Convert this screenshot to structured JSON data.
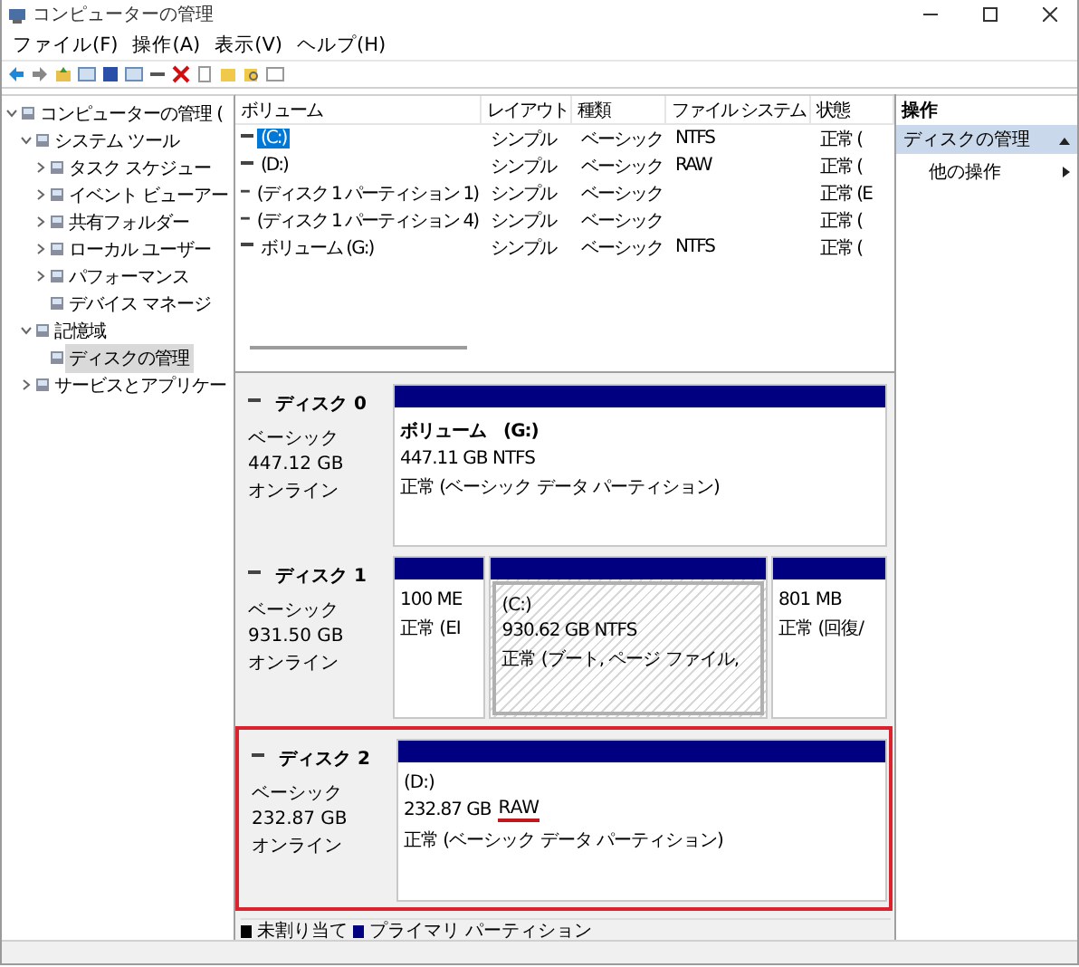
{
  "window": {
    "title": "コンピューターの管理"
  },
  "menu": [
    "ファイル(F)",
    "操作(A)",
    "表示(V)",
    "ヘルプ(H)"
  ],
  "tree": [
    {
      "label": "コンピューターの管理 (",
      "expanded": true,
      "selected": false,
      "children": [
        {
          "label": "システム ツール",
          "expanded": true,
          "selected": false,
          "children": [
            {
              "label": "タスク スケジュー",
              "expanded": false,
              "selected": false
            },
            {
              "label": "イベント ビューアー",
              "expanded": false,
              "selected": false
            },
            {
              "label": "共有フォルダー",
              "expanded": false,
              "selected": false
            },
            {
              "label": "ローカル ユーザー",
              "expanded": false,
              "selected": false
            },
            {
              "label": "パフォーマンス",
              "expanded": false,
              "selected": false
            },
            {
              "label": "デバイス マネージ",
              "selected": false
            }
          ]
        },
        {
          "label": "記憶域",
          "expanded": true,
          "selected": false,
          "children": [
            {
              "label": "ディスクの管理",
              "selected": true
            }
          ]
        },
        {
          "label": "サービスとアプリケー",
          "expanded": false,
          "selected": false
        }
      ]
    }
  ],
  "volume_table": {
    "columns": [
      "ボリューム",
      "レイアウト",
      "種類",
      "ファイル システム",
      "状態"
    ],
    "rows": [
      {
        "cells": [
          "(C:)",
          "シンプル",
          "ベーシック",
          "NTFS",
          "正常 ("
        ],
        "selected": true
      },
      {
        "cells": [
          "(D:)",
          "シンプル",
          "ベーシック",
          "RAW",
          "正常 ("
        ],
        "selected": false
      },
      {
        "cells": [
          "(ディスク 1 パーティション 1)",
          "シンプル",
          "ベーシック",
          "",
          "正常 (E"
        ],
        "selected": false
      },
      {
        "cells": [
          "(ディスク 1 パーティション 4)",
          "シンプル",
          "ベーシック",
          "",
          "正常 ("
        ],
        "selected": false
      },
      {
        "cells": [
          "ボリューム (G:)",
          "シンプル",
          "ベーシック",
          "NTFS",
          "正常 ("
        ],
        "selected": false
      }
    ]
  },
  "disks": [
    {
      "name": "ディスク 0",
      "type": "ベーシック",
      "size": "447.12 GB",
      "status": "オンライン",
      "highlighted": false,
      "partitions": [
        {
          "name": "ボリューム　(G:)",
          "size": "447.11 GB NTFS",
          "status": "正常 (ベーシック データ パーティション)",
          "selected": false
        }
      ]
    },
    {
      "name": "ディスク 1",
      "type": "ベーシック",
      "size": "931.50 GB",
      "status": "オンライン",
      "highlighted": false,
      "partitions": [
        {
          "size": "100 ME",
          "status": "正常 (EI",
          "selected": false
        },
        {
          "name": "(C:)",
          "size": "930.62 GB NTFS",
          "status": "正常 (ブート, ページ ファイル,",
          "selected": true
        },
        {
          "size": "801 MB",
          "status": "正常 (回復/",
          "selected": false
        }
      ]
    },
    {
      "name": "ディスク 2",
      "type": "ベーシック",
      "size": "232.87 GB",
      "status": "オンライン",
      "highlighted": true,
      "partitions": [
        {
          "name": "(D:)",
          "size": "232.87 GB",
          "fs": "RAW",
          "fs_underlined": true,
          "status": "正常 (ベーシック データ パーティション)",
          "selected": false
        }
      ]
    }
  ],
  "legend": [
    {
      "label": "未割り当て",
      "color": "#000000"
    },
    {
      "label": "プライマリ パーティション",
      "color": "#000080"
    }
  ],
  "actions": {
    "title": "操作",
    "section": "ディスクの管理",
    "items": [
      "他の操作"
    ]
  }
}
